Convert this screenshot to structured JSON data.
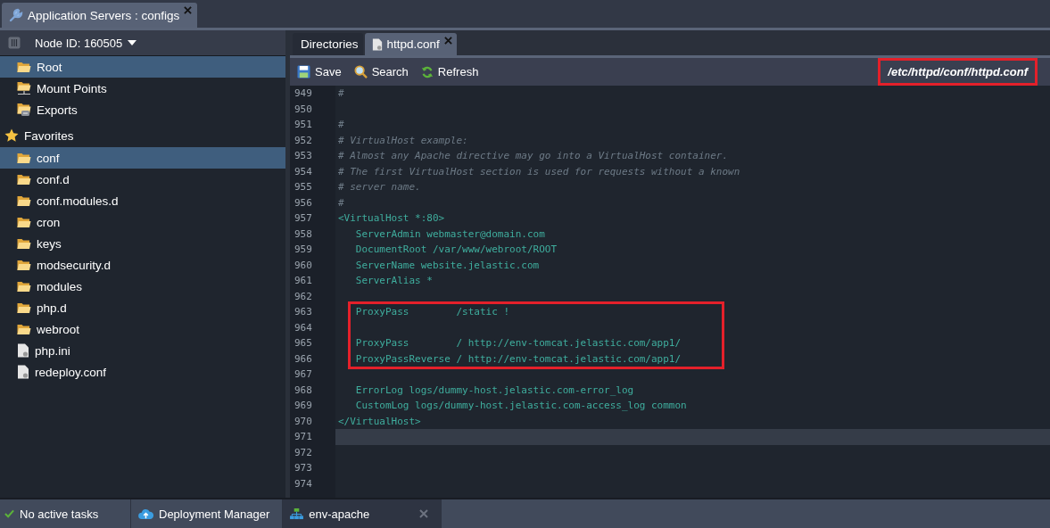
{
  "top_tabs": [
    {
      "label": "Application Servers : configs",
      "selected": true
    }
  ],
  "sidebar": {
    "node_selector": "Node ID: 160505",
    "items": [
      {
        "label": "Root",
        "kind": "folder",
        "selected": true
      },
      {
        "label": "Mount Points",
        "kind": "mount",
        "selected": false
      },
      {
        "label": "Exports",
        "kind": "export",
        "selected": false
      },
      {
        "label": "Favorites",
        "kind": "star",
        "selected": false,
        "children": [
          {
            "label": "conf",
            "kind": "folder",
            "selected": true
          },
          {
            "label": "conf.d",
            "kind": "folder",
            "selected": false
          },
          {
            "label": "conf.modules.d",
            "kind": "folder",
            "selected": false
          },
          {
            "label": "cron",
            "kind": "folder",
            "selected": false
          },
          {
            "label": "keys",
            "kind": "folder",
            "selected": false
          },
          {
            "label": "modsecurity.d",
            "kind": "folder",
            "selected": false
          },
          {
            "label": "modules",
            "kind": "folder",
            "selected": false
          },
          {
            "label": "php.d",
            "kind": "folder",
            "selected": false
          },
          {
            "label": "webroot",
            "kind": "folder",
            "selected": false
          },
          {
            "label": "php.ini",
            "kind": "file",
            "selected": false
          },
          {
            "label": "redeploy.conf",
            "kind": "file",
            "selected": false
          }
        ]
      }
    ]
  },
  "editor": {
    "tabs": [
      {
        "label": "Directories",
        "selected": false,
        "closable": false
      },
      {
        "label": "httpd.conf",
        "selected": true,
        "closable": true
      }
    ],
    "toolbar": [
      {
        "label": "Save",
        "kind": "save"
      },
      {
        "label": "Search",
        "kind": "search"
      },
      {
        "label": "Refresh",
        "kind": "refresh"
      }
    ],
    "path": {
      "text": "/etc/httpd/conf/httpd.conf",
      "boxed": true
    },
    "lines": [
      {
        "number": "949",
        "text": "#",
        "kind": "comment",
        "boxed": false,
        "current": false
      },
      {
        "number": "950",
        "kind": "comment",
        "boxed": false,
        "current": false
      },
      {
        "number": "951",
        "text": "#",
        "kind": "comment",
        "boxed": false,
        "current": false
      },
      {
        "number": "952",
        "text": "# VirtualHost example:",
        "kind": "comment",
        "boxed": false,
        "current": false
      },
      {
        "number": "953",
        "text": "# Almost any Apache directive may go into a VirtualHost container.",
        "kind": "comment",
        "boxed": false,
        "current": false
      },
      {
        "number": "954",
        "text": "# The first VirtualHost section is used for requests without a known",
        "kind": "comment",
        "boxed": false,
        "current": false
      },
      {
        "number": "955",
        "text": "# server name.",
        "kind": "comment",
        "boxed": false,
        "current": false
      },
      {
        "number": "956",
        "text": "#",
        "kind": "comment",
        "boxed": false,
        "current": false
      },
      {
        "number": "957",
        "text": "<VirtualHost *:80>",
        "kind": "code",
        "boxed": false,
        "current": false
      },
      {
        "number": "958",
        "text": "   ServerAdmin webmaster@domain.com",
        "kind": "code",
        "boxed": false,
        "current": false
      },
      {
        "number": "959",
        "text": "   DocumentRoot /var/www/webroot/ROOT",
        "kind": "code",
        "boxed": false,
        "current": false
      },
      {
        "number": "960",
        "text": "   ServerName website.jelastic.com",
        "kind": "code",
        "boxed": false,
        "current": false
      },
      {
        "number": "961",
        "text": "   ServerAlias *",
        "kind": "code",
        "boxed": false,
        "current": false
      },
      {
        "number": "962",
        "kind": "code",
        "boxed": false,
        "current": false
      },
      {
        "number": "963",
        "text": "   ProxyPass        /static !",
        "kind": "code",
        "boxed": true,
        "current": false
      },
      {
        "number": "964",
        "kind": "code",
        "boxed": true,
        "current": false
      },
      {
        "number": "965",
        "text": "   ProxyPass        / http://env-tomcat.jelastic.com/app1/",
        "kind": "code",
        "boxed": true,
        "current": false
      },
      {
        "number": "966",
        "text": "   ProxyPassReverse / http://env-tomcat.jelastic.com/app1/",
        "kind": "code",
        "boxed": true,
        "current": false
      },
      {
        "number": "967",
        "kind": "code",
        "boxed": false,
        "current": false
      },
      {
        "number": "968",
        "text": "   ErrorLog logs/dummy-host.jelastic.com-error_log",
        "kind": "code",
        "boxed": false,
        "current": false
      },
      {
        "number": "969",
        "text": "   CustomLog logs/dummy-host.jelastic.com-access_log common",
        "kind": "code",
        "boxed": false,
        "current": false
      },
      {
        "number": "970",
        "text": "</VirtualHost>",
        "kind": "code",
        "boxed": false,
        "current": false
      },
      {
        "number": "971",
        "kind": "code",
        "boxed": false,
        "current": true
      },
      {
        "number": "972",
        "kind": "code",
        "boxed": false,
        "current": false
      },
      {
        "number": "973",
        "kind": "code",
        "boxed": false,
        "current": false
      },
      {
        "number": "974",
        "kind": "code",
        "boxed": false,
        "current": false
      }
    ]
  },
  "status_bar": [
    {
      "label": "No active tasks",
      "kind": "tasks",
      "selected": false,
      "closable": false
    },
    {
      "label": "Deployment Manager",
      "kind": "cloud",
      "selected": false,
      "closable": false
    },
    {
      "label": "env-apache",
      "kind": "env",
      "selected": true,
      "closable": true
    }
  ]
}
